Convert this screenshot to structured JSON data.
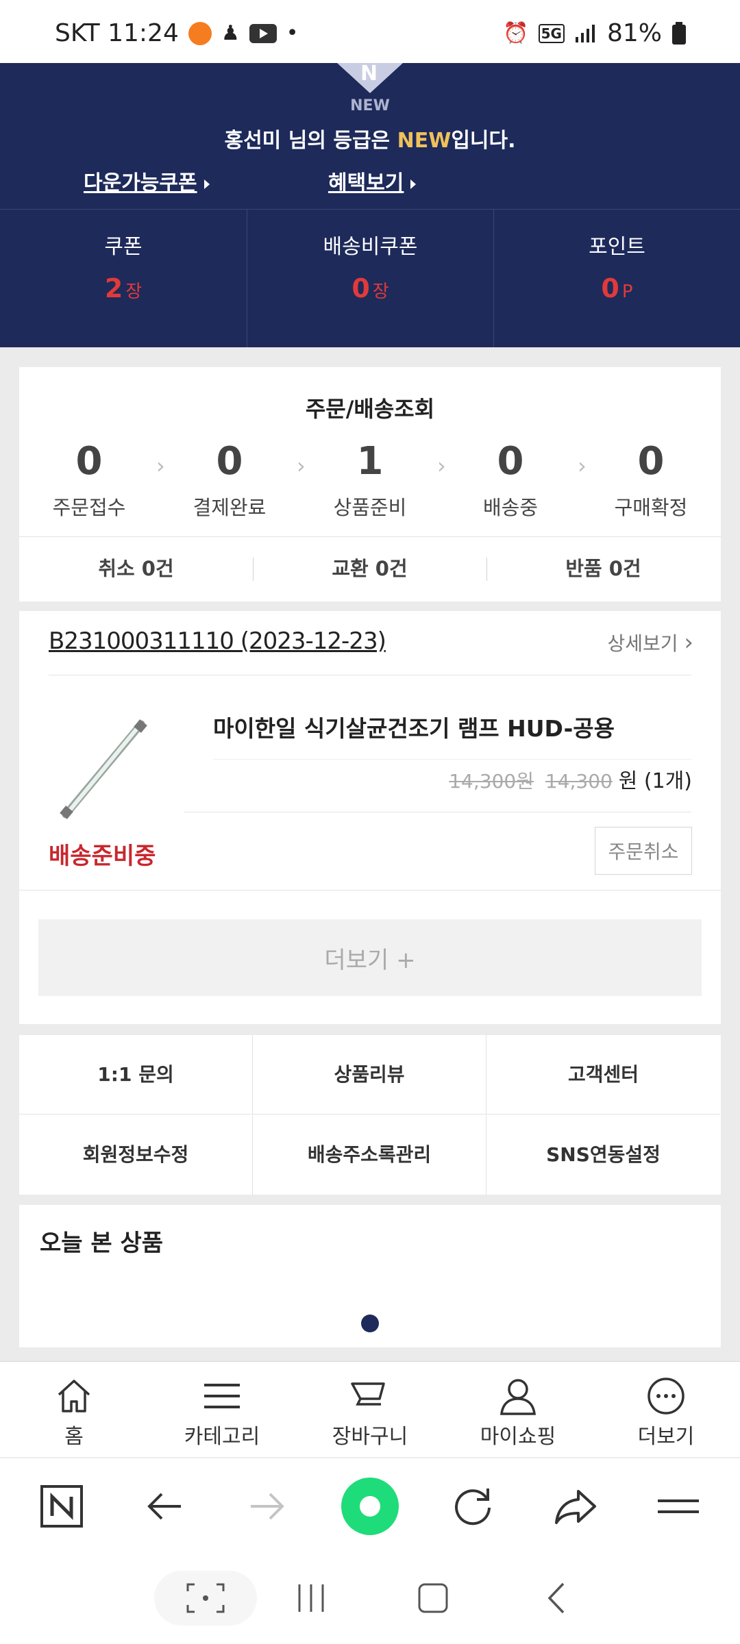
{
  "status_bar": {
    "carrier_time": "SKT 11:24",
    "battery": "81%"
  },
  "grade": {
    "badge_label": "NEW",
    "msg_prefix": "홍선미 님의 등급은 ",
    "msg_grade": "NEW",
    "msg_suffix": "입니다.",
    "coupon_link": "다운가능쿠폰",
    "benefit_link": "혜택보기",
    "benefits": [
      {
        "title": "쿠폰",
        "value": "2",
        "unit": "장"
      },
      {
        "title": "배송비쿠폰",
        "value": "0",
        "unit": "장"
      },
      {
        "title": "포인트",
        "value": "0",
        "unit": "P"
      }
    ]
  },
  "order_status": {
    "title": "주문/배송조회",
    "steps": [
      {
        "count": "0",
        "label": "주문접수"
      },
      {
        "count": "0",
        "label": "결제완료"
      },
      {
        "count": "1",
        "label": "상품준비"
      },
      {
        "count": "0",
        "label": "배송중"
      },
      {
        "count": "0",
        "label": "구매확정"
      }
    ],
    "claims": [
      "취소 0건",
      "교환 0건",
      "반품 0건"
    ]
  },
  "order": {
    "order_no": "B231000311110 (2023-12-23)",
    "detail_link": "상세보기",
    "product_name": "마이한일 식기살균건조기 램프 HUD-공용",
    "original_price": "14,300원",
    "sale_price": "14,300",
    "price_suffix": "원 (1개)",
    "status": "배송준비중",
    "cancel_button": "주문취소",
    "more_button": "더보기 +"
  },
  "menu": [
    "1:1 문의",
    "상품리뷰",
    "고객센터",
    "회원정보수정",
    "배송주소록관리",
    "SNS연동설정"
  ],
  "today": {
    "title": "오늘 본 상품"
  },
  "bottom_nav": [
    "홈",
    "카테고리",
    "장바구니",
    "마이쇼핑",
    "더보기"
  ],
  "colors": {
    "navy": "#1d2a5a",
    "accent_red": "#c8272e",
    "grade_gold": "#f0c15a"
  }
}
